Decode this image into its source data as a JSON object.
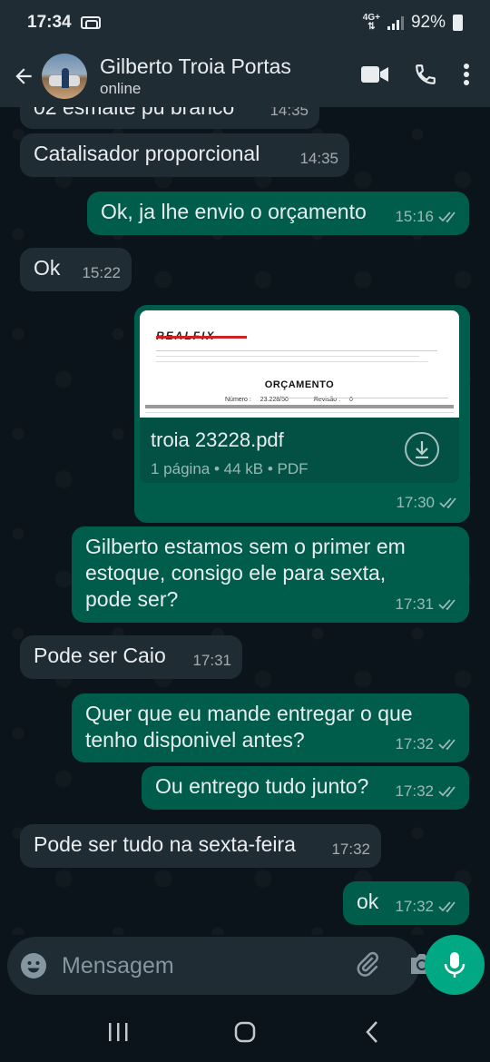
{
  "status_bar": {
    "time": "17:34",
    "network": "4G+",
    "battery": "92%"
  },
  "header": {
    "contact_name": "Gilberto Troia Portas",
    "presence": "online",
    "icons": [
      "back-arrow-icon",
      "video-call-icon",
      "voice-call-icon",
      "more-options-icon"
    ]
  },
  "messages": [
    {
      "direction": "in",
      "text": "02 esmalte pu branco",
      "time": "14:35"
    },
    {
      "direction": "in",
      "text": "Catalisador proporcional",
      "time": "14:35"
    },
    {
      "direction": "out",
      "text": "Ok, ja lhe envio o orçamento",
      "time": "15:16",
      "status": "read"
    },
    {
      "direction": "in",
      "text": "Ok",
      "time": "15:22"
    },
    {
      "direction": "out",
      "type": "document",
      "time": "17:30",
      "status": "read",
      "document": {
        "file_name": "troia 23228.pdf",
        "details": "1 página • 44 kB • PDF",
        "preview": {
          "logo": "REALFIX",
          "title": "ORÇAMENTO",
          "number_label": "Número :",
          "number_value": "23.228/50",
          "revision_label": "Revisão :",
          "revision_value": "0"
        }
      }
    },
    {
      "direction": "out",
      "text": "Gilberto estamos sem o primer em estoque, consigo ele para sexta, pode ser?",
      "time": "17:31",
      "status": "read"
    },
    {
      "direction": "in",
      "text": "Pode ser Caio",
      "time": "17:31"
    },
    {
      "direction": "out",
      "text": "Quer que eu mande entregar o que tenho disponivel antes?",
      "time": "17:32",
      "status": "read"
    },
    {
      "direction": "out",
      "text": "Ou entrego tudo junto?",
      "time": "17:32",
      "status": "read"
    },
    {
      "direction": "in",
      "text": "Pode ser tudo na sexta-feira",
      "time": "17:32"
    },
    {
      "direction": "out",
      "text": "ok",
      "time": "17:32",
      "status": "read"
    }
  ],
  "composer": {
    "placeholder": "Mensagem"
  },
  "colors": {
    "background": "#0b141a",
    "incoming_bubble": "#202c33",
    "outgoing_bubble": "#005c4b",
    "accent": "#00a884",
    "header": "#1f2c34"
  }
}
